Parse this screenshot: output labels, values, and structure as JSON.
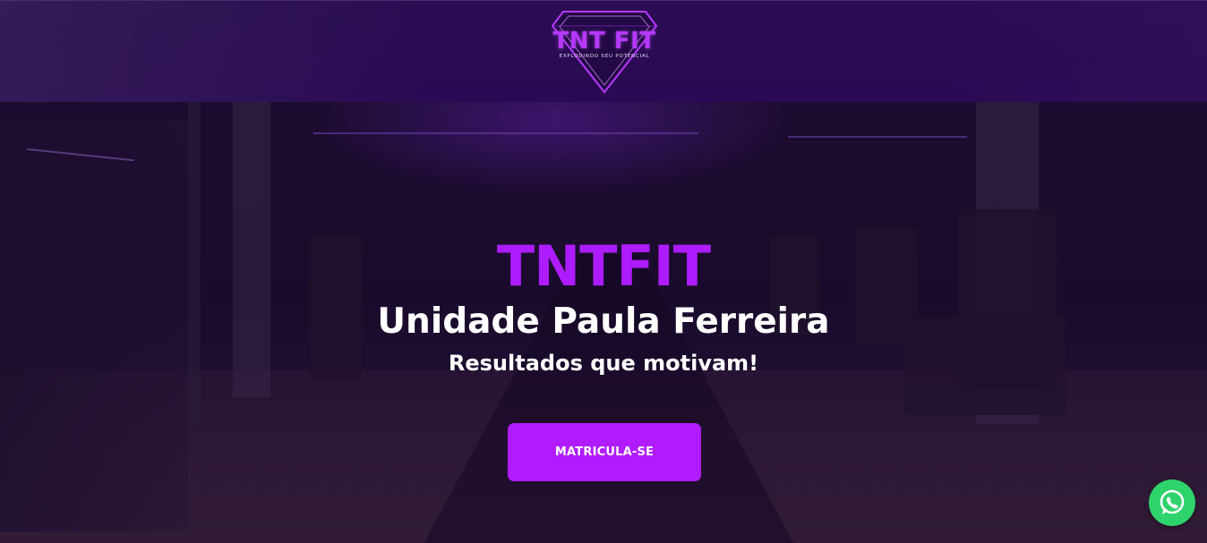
{
  "header": {
    "logo": {
      "title": "TNT FIT",
      "subtitle": "EXPLODINDO SEU POTENCIAL",
      "icon": "diamond-badge-icon",
      "accent_color": "#b638ff"
    }
  },
  "hero": {
    "brand": "TNTFIT",
    "title": "Unidade Paula Ferreira",
    "tagline": "Resultados que motivam!",
    "cta_label": "MATRICULA-SE",
    "brand_color": "#ad1cff",
    "cta_color": "#b01cff"
  },
  "floating": {
    "whatsapp_icon": "whatsapp-icon",
    "whatsapp_color": "#2fd36b"
  }
}
